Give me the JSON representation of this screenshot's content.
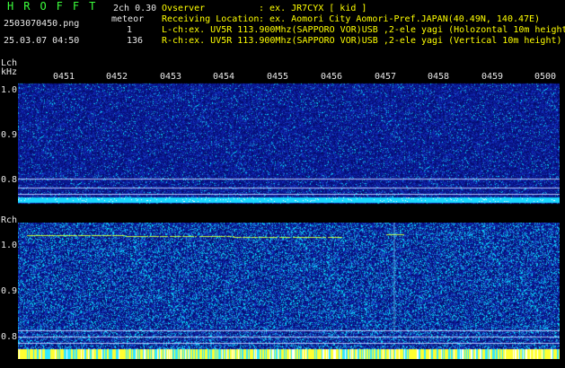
{
  "header": {
    "brand": "HROFFT",
    "filename": "2503070450.png",
    "datetime": "25.03.07 04:50",
    "channel_mode": "2ch 0.30",
    "meteor_label": "meteor",
    "meteor_count_l": "1",
    "meteor_count_r": "136",
    "observer_label": "Ovserver",
    "observer_value": ": ex. JR7CYX [ kid ]",
    "location_label": "Receiving Location",
    "location_value": ": ex. Aomori City Aomori-Pref.JAPAN(40.49N, 140.47E)",
    "lch_info": "L-ch:ex. UV5R 113.900Mhz(SAPPORO VOR)USB ,2-ele yagi (Holozontal 10m height)",
    "rch_info": "R-ch:ex. UV5R 113.900Mhz(SAPPORO VOR)USB ,2-ele yagi (Vertical 10m height)"
  },
  "lch": {
    "name": "Lch",
    "unit": "kHz",
    "y_ticks": [
      "1.0",
      "0.9",
      "0.8"
    ],
    "time_labels": [
      "0451",
      "0452",
      "0453",
      "0454",
      "0455",
      "0456",
      "0457",
      "0458",
      "0459",
      "0500"
    ]
  },
  "rch": {
    "name": "Rch",
    "y_ticks": [
      "1.0",
      "0.9",
      "0.8"
    ]
  },
  "colors": {
    "background": "#000000",
    "header_yellow": "#ffff00",
    "header_green": "#3cff3c",
    "noise_base": "#0a1a8c",
    "noise_cyan": "#00ffff",
    "noise_yellow": "#ffff00",
    "tick_white": "#e8e8e8"
  }
}
